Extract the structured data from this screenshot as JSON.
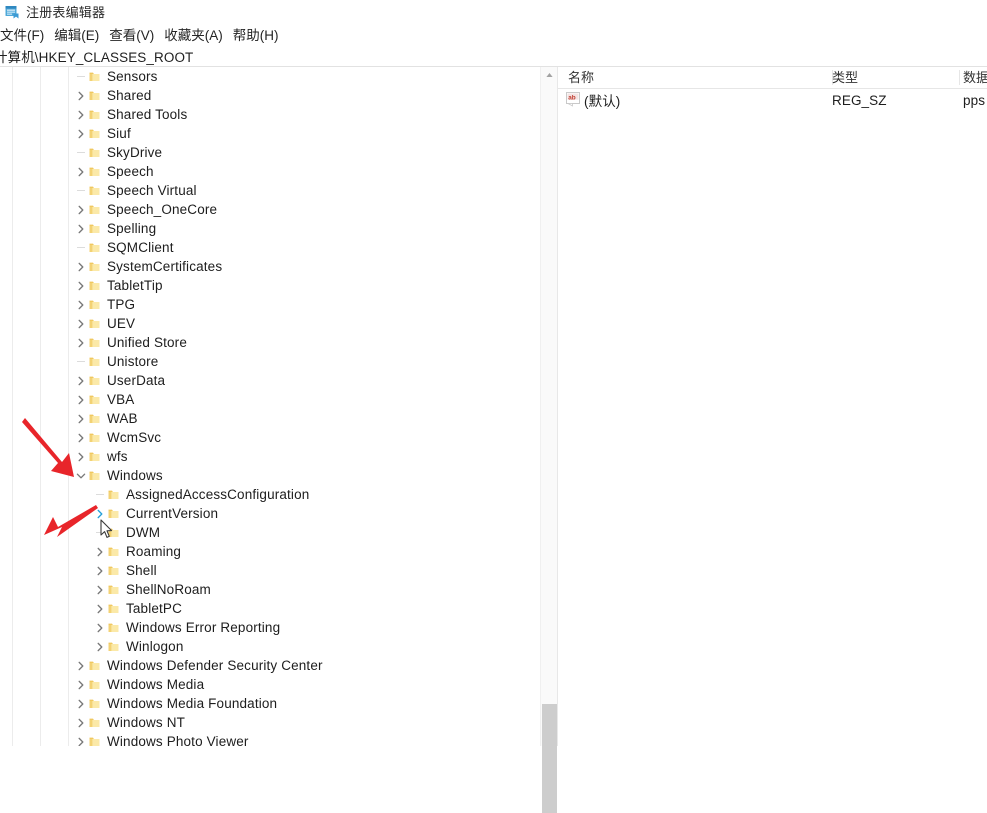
{
  "window": {
    "title": "注册表编辑器",
    "icon": "registry-editor-icon"
  },
  "menubar": {
    "items": [
      {
        "label": "文件(F)",
        "name": "menu-file"
      },
      {
        "label": "编辑(E)",
        "name": "menu-edit"
      },
      {
        "label": "查看(V)",
        "name": "menu-view"
      },
      {
        "label": "收藏夹(A)",
        "name": "menu-favorites"
      },
      {
        "label": "帮助(H)",
        "name": "menu-help"
      }
    ]
  },
  "addressbar": {
    "path": "计算机\\HKEY_CLASSES_ROOT"
  },
  "tree": {
    "rows": [
      {
        "label": "Sensors",
        "depth": 0,
        "state": "leaf"
      },
      {
        "label": "Shared",
        "depth": 0,
        "state": "collapsed"
      },
      {
        "label": "Shared Tools",
        "depth": 0,
        "state": "collapsed"
      },
      {
        "label": "Siuf",
        "depth": 0,
        "state": "collapsed"
      },
      {
        "label": "SkyDrive",
        "depth": 0,
        "state": "leaf"
      },
      {
        "label": "Speech",
        "depth": 0,
        "state": "collapsed"
      },
      {
        "label": "Speech Virtual",
        "depth": 0,
        "state": "leaf"
      },
      {
        "label": "Speech_OneCore",
        "depth": 0,
        "state": "collapsed"
      },
      {
        "label": "Spelling",
        "depth": 0,
        "state": "collapsed"
      },
      {
        "label": "SQMClient",
        "depth": 0,
        "state": "leaf"
      },
      {
        "label": "SystemCertificates",
        "depth": 0,
        "state": "collapsed"
      },
      {
        "label": "TabletTip",
        "depth": 0,
        "state": "collapsed"
      },
      {
        "label": "TPG",
        "depth": 0,
        "state": "collapsed"
      },
      {
        "label": "UEV",
        "depth": 0,
        "state": "collapsed"
      },
      {
        "label": "Unified Store",
        "depth": 0,
        "state": "collapsed"
      },
      {
        "label": "Unistore",
        "depth": 0,
        "state": "leaf"
      },
      {
        "label": "UserData",
        "depth": 0,
        "state": "collapsed"
      },
      {
        "label": "VBA",
        "depth": 0,
        "state": "collapsed"
      },
      {
        "label": "WAB",
        "depth": 0,
        "state": "collapsed"
      },
      {
        "label": "WcmSvc",
        "depth": 0,
        "state": "collapsed"
      },
      {
        "label": "wfs",
        "depth": 0,
        "state": "collapsed"
      },
      {
        "label": "Windows",
        "depth": 0,
        "state": "expanded"
      },
      {
        "label": "AssignedAccessConfiguration",
        "depth": 1,
        "state": "leaf"
      },
      {
        "label": "CurrentVersion",
        "depth": 1,
        "state": "collapsed-highlight"
      },
      {
        "label": "DWM",
        "depth": 1,
        "state": "leaf"
      },
      {
        "label": "Roaming",
        "depth": 1,
        "state": "collapsed"
      },
      {
        "label": "Shell",
        "depth": 1,
        "state": "collapsed"
      },
      {
        "label": "ShellNoRoam",
        "depth": 1,
        "state": "collapsed"
      },
      {
        "label": "TabletPC",
        "depth": 1,
        "state": "collapsed"
      },
      {
        "label": "Windows Error Reporting",
        "depth": 1,
        "state": "collapsed"
      },
      {
        "label": "Winlogon",
        "depth": 1,
        "state": "collapsed"
      },
      {
        "label": "Windows Defender Security Center",
        "depth": 0,
        "state": "collapsed"
      },
      {
        "label": "Windows Media",
        "depth": 0,
        "state": "collapsed"
      },
      {
        "label": "Windows Media Foundation",
        "depth": 0,
        "state": "collapsed"
      },
      {
        "label": "Windows NT",
        "depth": 0,
        "state": "collapsed"
      },
      {
        "label": "Windows Photo Viewer",
        "depth": 0,
        "state": "collapsed"
      }
    ]
  },
  "list": {
    "columns": [
      {
        "label": "名称",
        "name": "column-name"
      },
      {
        "label": "类型",
        "name": "column-type"
      },
      {
        "label": "数据",
        "name": "column-data"
      }
    ],
    "rows": [
      {
        "name": "(默认)",
        "type": "REG_SZ",
        "data": "pps",
        "icon": "string-value-icon"
      }
    ]
  },
  "annotations": {
    "arrow_windows": "red-arrow-pointing-to-windows-expander",
    "arrow_currentversion": "red-arrow-pointing-to-currentversion-expander",
    "cursor": "mouse-pointer"
  },
  "colors": {
    "folder": "#f5d67a",
    "annotation_red": "#e8252a",
    "chevron_highlight": "#26a0da",
    "scrollbar_thumb": "#cdcdcd"
  }
}
